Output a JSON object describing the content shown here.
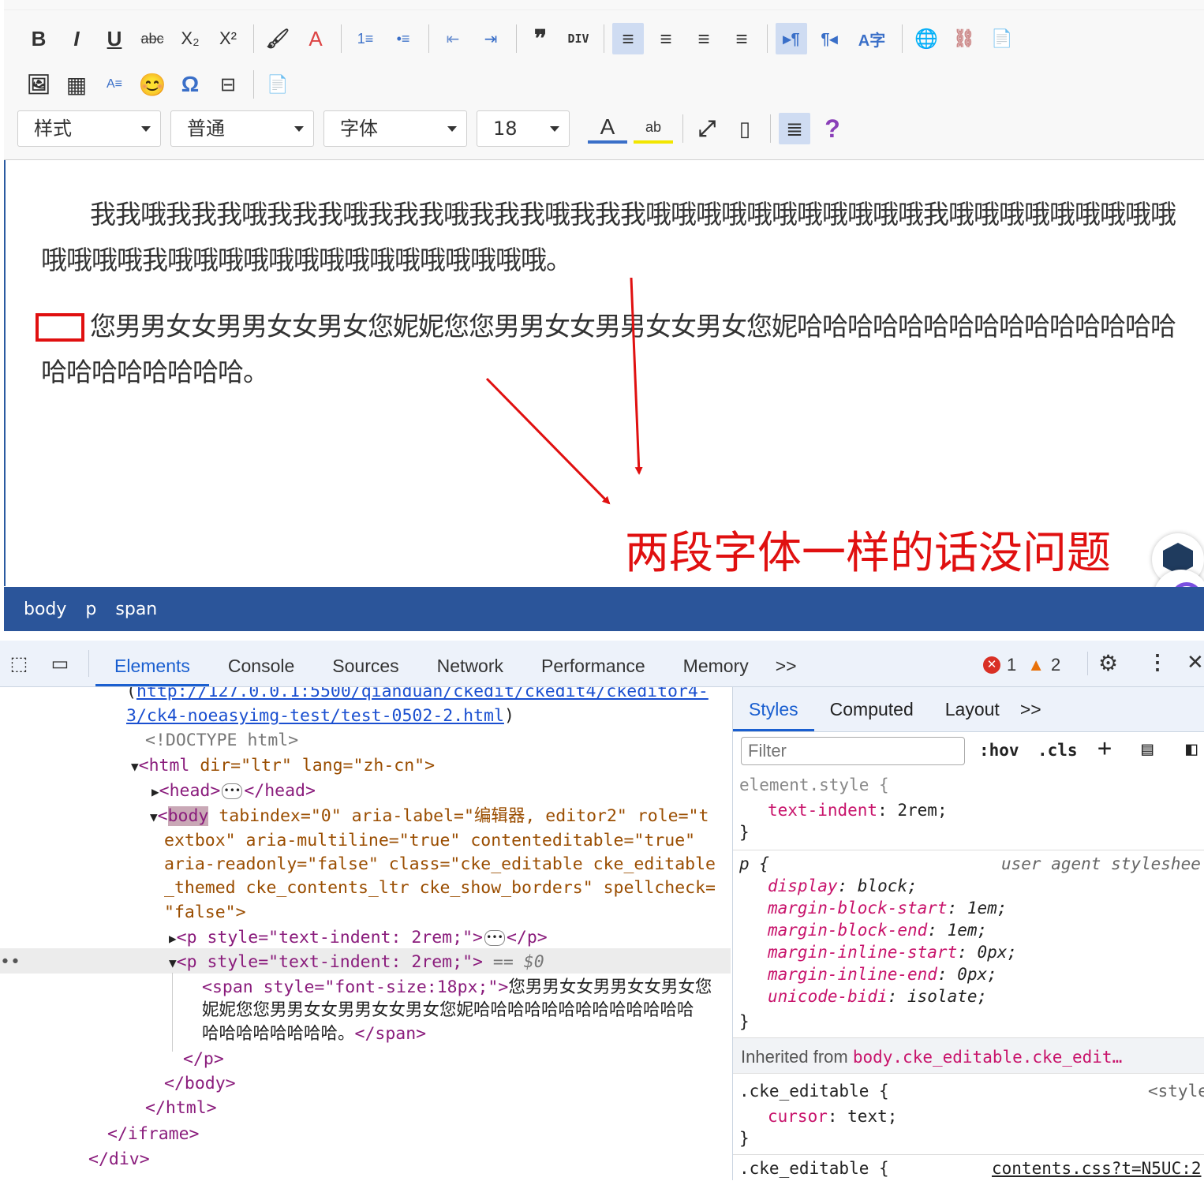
{
  "editor": {
    "toolbar_row2": [
      "B",
      "I",
      "U",
      "abc",
      "X₂",
      "X²",
      "🖌",
      "A",
      "1≡",
      "•≡",
      "⇤",
      "⇥",
      "❞",
      "DIV",
      "≡",
      "≡",
      "≡",
      "≡",
      "▸¶",
      "¶◂",
      "A字",
      "🌐",
      "⛓",
      "📄"
    ],
    "toolbar_row3": [
      "🖼",
      "▦",
      "A≡",
      "😊",
      "Ω",
      "⊟",
      "📄"
    ],
    "combos": {
      "style": "样式",
      "format": "普通",
      "font": "字体",
      "size": "18"
    },
    "toolbar_row4_extra": [
      "A",
      "ab",
      "⤢",
      "▯",
      "≣",
      "?"
    ],
    "paragraph1": "我我哦我我我哦我我我哦我我我哦我我我哦我我我哦哦哦哦哦哦哦哦哦哦哦我哦哦哦哦哦哦哦哦哦哦哦哦哦我哦哦哦哦哦哦哦哦哦哦哦哦哦哦哦。",
    "paragraph2": "您男男女女男男女女男女您妮妮您您男男女女男男女女男女您妮哈哈哈哈哈哈哈哈哈哈哈哈哈哈哈哈哈哈哈哈哈哈哈。",
    "annotation": "两段字体一样的话没问题",
    "path": [
      "body",
      "p",
      "span"
    ]
  },
  "devtools": {
    "tabs": [
      "Elements",
      "Console",
      "Sources",
      "Network",
      "Performance",
      "Memory",
      ">>"
    ],
    "errors": "1",
    "warnings": "2",
    "elements": {
      "url1": "http://127.0.0.1:5500/qianduan/ckedit/ckedit4/ckeditor4-",
      "url2": "3/ck4-noeasyimg-test/test-0502-2.html",
      "doctype": "<!DOCTYPE html>",
      "html_open": "<html",
      "html_attrs": " dir=\"ltr\" lang=\"zh-cn\">",
      "head": "<head>",
      "head_close": "</head>",
      "body_tag": "body",
      "body_l1": " tabindex=\"0\" aria-label=\"编辑器, editor2\" role=\"t",
      "body_l2": "extbox\" aria-multiline=\"true\" contenteditable=\"true\"",
      "body_l3": "aria-readonly=\"false\" class=\"cke_editable cke_editable",
      "body_l4": "_themed cke_contents_ltr cke_show_borders\" spellcheck=",
      "body_l5": "\"false\">",
      "p1": "<p style=\"text-indent: 2rem;\">",
      "p1_close": "</p>",
      "p2": "<p style=\"text-indent: 2rem;\">",
      "p2_suffix": " == $0",
      "span_open": "<span style=\"font-size:18px;\">",
      "span_text1": "您男男女女男男女女男女您",
      "span_text2": "妮妮您您男男女女男男女女男女您妮哈哈哈哈哈哈哈哈哈哈哈哈哈",
      "span_text3": "哈哈哈哈哈哈哈哈。",
      "span_close": "</span>",
      "p_close": "</p>",
      "body_close": "</body>",
      "html_close": "</html>",
      "iframe_close": "</iframe>",
      "div_close": "</div>"
    },
    "styles": {
      "tabs": [
        "Styles",
        "Computed",
        "Layout",
        ">>"
      ],
      "filter_placeholder": "Filter",
      "hov": ":hov",
      "cls": ".cls",
      "element_style": "element.style {",
      "text_indent_prop": "text-indent",
      "text_indent_val": "2rem;",
      "p_selector": "p {",
      "ua": "user agent styleshee",
      "ua_props": [
        [
          "display",
          "block;"
        ],
        [
          "margin-block-start",
          "1em;"
        ],
        [
          "margin-block-end",
          "1em;"
        ],
        [
          "margin-inline-start",
          "0px;"
        ],
        [
          "margin-inline-end",
          "0px;"
        ],
        [
          "unicode-bidi",
          "isolate;"
        ]
      ],
      "inherited_label": "Inherited from ",
      "inherited_from": "body.cke_editable.cke_edit…",
      "cke_selector": ".cke_editable {",
      "style_src": "<style",
      "cursor_prop": "cursor",
      "cursor_val": "text;",
      "cke_selector2": ".cke_editable {",
      "contents_src": "contents.css?t=N5UC:2"
    }
  }
}
